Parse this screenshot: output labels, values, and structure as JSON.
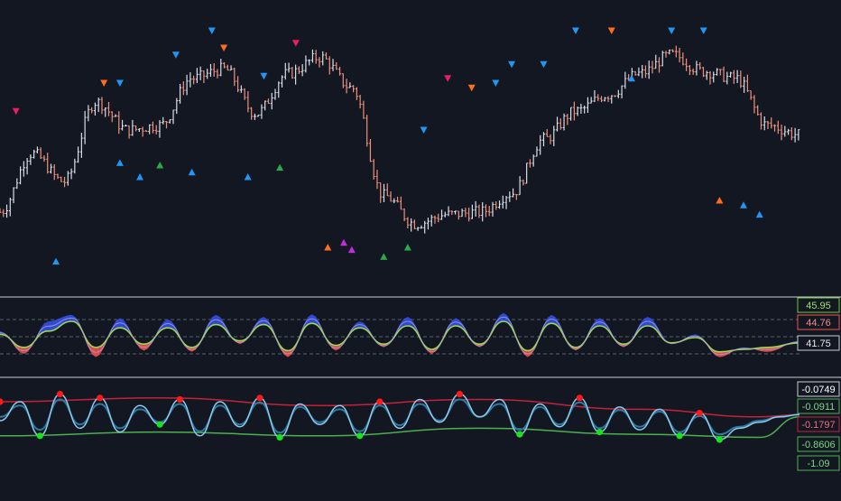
{
  "theme": {
    "background": "#131722",
    "separator": "#c8ccd4",
    "bar_up": "#d8dde6",
    "bar_down": "#f0907c",
    "signal_blue": "#2196f3",
    "signal_orange": "#ff6d1f",
    "signal_pink": "#e91e63",
    "signal_purple": "#c02ddb",
    "signal_green": "#2ea84a",
    "osc_fill_up": "#3550e6",
    "osc_fill_down": "#ef5350",
    "osc_line_green": "#9bd84f",
    "osc_line_purple": "#b39ddb",
    "wt_line_light": "#8ec8e8",
    "wt_line_dark": "#2a7aa5",
    "wt_upper_red": "#c2233a",
    "wt_lower_green": "#4caf50",
    "dot_red": "#ff1a1a",
    "dot_green": "#18e31e"
  },
  "chart_data": [
    {
      "type": "line",
      "panel": "price",
      "style": "ohlc-bars",
      "x_range": [
        0,
        200
      ],
      "y_range": [
        0,
        100
      ],
      "grid": false,
      "series": [
        {
          "x": [
            0,
            8,
            16,
            24,
            32,
            40,
            48,
            56,
            64,
            72,
            80,
            88,
            96,
            104,
            112,
            120,
            128,
            136,
            144,
            152,
            160,
            168,
            176,
            184,
            192,
            200
          ],
          "values": [
            25,
            50,
            38,
            72,
            60,
            62,
            82,
            86,
            67,
            84,
            91,
            78,
            32,
            20,
            24,
            25,
            33,
            56,
            68,
            75,
            84,
            92,
            85,
            82,
            62,
            58
          ]
        }
      ],
      "markers": [
        {
          "x": 4,
          "y": 68,
          "direction": "down",
          "color": "pink"
        },
        {
          "x": 14,
          "y": 4,
          "direction": "up",
          "color": "blue"
        },
        {
          "x": 26,
          "y": 80,
          "direction": "down",
          "color": "orange"
        },
        {
          "x": 30,
          "y": 80,
          "direction": "down",
          "color": "blue"
        },
        {
          "x": 30,
          "y": 46,
          "direction": "up",
          "color": "blue"
        },
        {
          "x": 35,
          "y": 40,
          "direction": "up",
          "color": "blue"
        },
        {
          "x": 40,
          "y": 45,
          "direction": "up",
          "color": "green"
        },
        {
          "x": 44,
          "y": 92,
          "direction": "down",
          "color": "blue"
        },
        {
          "x": 48,
          "y": 42,
          "direction": "up",
          "color": "blue"
        },
        {
          "x": 53,
          "y": 104,
          "direction": "down",
          "color": "blue"
        },
        {
          "x": 56,
          "y": 95,
          "direction": "down",
          "color": "orange"
        },
        {
          "x": 62,
          "y": 40,
          "direction": "up",
          "color": "blue"
        },
        {
          "x": 66,
          "y": 83,
          "direction": "down",
          "color": "blue"
        },
        {
          "x": 70,
          "y": 44,
          "direction": "up",
          "color": "green"
        },
        {
          "x": 74,
          "y": 97,
          "direction": "down",
          "color": "pink"
        },
        {
          "x": 82,
          "y": 10,
          "direction": "up",
          "color": "orange"
        },
        {
          "x": 86,
          "y": 12,
          "direction": "up",
          "color": "purple"
        },
        {
          "x": 88,
          "y": 9,
          "direction": "up",
          "color": "purple"
        },
        {
          "x": 96,
          "y": 6,
          "direction": "up",
          "color": "green"
        },
        {
          "x": 102,
          "y": 10,
          "direction": "up",
          "color": "green"
        },
        {
          "x": 106,
          "y": 60,
          "direction": "down",
          "color": "blue"
        },
        {
          "x": 112,
          "y": 82,
          "direction": "down",
          "color": "pink"
        },
        {
          "x": 118,
          "y": 78,
          "direction": "down",
          "color": "orange"
        },
        {
          "x": 124,
          "y": 80,
          "direction": "down",
          "color": "blue"
        },
        {
          "x": 128,
          "y": 88,
          "direction": "down",
          "color": "blue"
        },
        {
          "x": 136,
          "y": 88,
          "direction": "down",
          "color": "blue"
        },
        {
          "x": 144,
          "y": 105,
          "direction": "down",
          "color": "blue"
        },
        {
          "x": 153,
          "y": 130,
          "direction": "down",
          "color": "orange"
        },
        {
          "x": 158,
          "y": 82,
          "direction": "up",
          "color": "blue"
        },
        {
          "x": 168,
          "y": 120,
          "direction": "down",
          "color": "blue"
        },
        {
          "x": 176,
          "y": 115,
          "direction": "down",
          "color": "blue"
        },
        {
          "x": 180,
          "y": 30,
          "direction": "up",
          "color": "orange"
        },
        {
          "x": 186,
          "y": 28,
          "direction": "up",
          "color": "blue"
        },
        {
          "x": 190,
          "y": 24,
          "direction": "up",
          "color": "blue"
        }
      ]
    },
    {
      "type": "area",
      "panel": "oscillator",
      "x_range": [
        0,
        200
      ],
      "y_range": [
        0,
        100
      ],
      "grid": true,
      "scale_labels": [
        "45.95",
        "44.76",
        "41.75"
      ],
      "series": [
        {
          "x": [
            0,
            6,
            12,
            18,
            24,
            30,
            36,
            42,
            48,
            54,
            60,
            66,
            72,
            78,
            84,
            90,
            96,
            102,
            108,
            114,
            120,
            126,
            132,
            138,
            144,
            150,
            156,
            162,
            168,
            174,
            180,
            186,
            192,
            200
          ],
          "values": [
            60,
            25,
            75,
            85,
            20,
            80,
            30,
            78,
            28,
            85,
            40,
            82,
            20,
            86,
            30,
            75,
            35,
            82,
            25,
            80,
            35,
            88,
            20,
            85,
            30,
            80,
            35,
            82,
            40,
            55,
            20,
            35,
            28,
            45
          ]
        },
        {
          "x": [
            0,
            6,
            12,
            18,
            24,
            30,
            36,
            42,
            48,
            54,
            60,
            66,
            72,
            78,
            84,
            90,
            96,
            102,
            108,
            114,
            120,
            126,
            132,
            138,
            144,
            150,
            156,
            162,
            168,
            174,
            180,
            186,
            192,
            200
          ],
          "values": [
            55,
            35,
            60,
            75,
            35,
            65,
            40,
            65,
            35,
            70,
            45,
            70,
            30,
            72,
            38,
            65,
            40,
            68,
            32,
            68,
            40,
            75,
            30,
            72,
            35,
            68,
            40,
            68,
            42,
            50,
            28,
            32,
            35,
            42
          ]
        }
      ]
    },
    {
      "type": "line",
      "panel": "wave",
      "x_range": [
        0,
        200
      ],
      "y_range": [
        0,
        100
      ],
      "grid": false,
      "scale_labels": [
        "-0.0749",
        "-0.0911",
        "-0.1797",
        "-0.8606",
        "-1.09"
      ],
      "series": [
        {
          "x": [
            0,
            5,
            10,
            15,
            20,
            25,
            30,
            35,
            40,
            45,
            50,
            55,
            60,
            65,
            70,
            75,
            80,
            85,
            90,
            95,
            100,
            105,
            110,
            115,
            120,
            125,
            130,
            135,
            140,
            145,
            150,
            155,
            160,
            165,
            170,
            175,
            180,
            185,
            190,
            195,
            200
          ],
          "values": [
            50,
            75,
            30,
            85,
            40,
            80,
            35,
            70,
            45,
            78,
            30,
            75,
            42,
            80,
            28,
            72,
            45,
            70,
            30,
            75,
            40,
            78,
            48,
            85,
            55,
            78,
            32,
            72,
            42,
            80,
            35,
            68,
            38,
            65,
            30,
            60,
            25,
            40,
            48,
            55,
            58
          ]
        },
        {
          "x": [
            0,
            5,
            10,
            15,
            20,
            25,
            30,
            35,
            40,
            45,
            50,
            55,
            60,
            65,
            70,
            75,
            80,
            85,
            90,
            95,
            100,
            105,
            110,
            115,
            120,
            125,
            130,
            135,
            140,
            145,
            150,
            155,
            160,
            165,
            170,
            175,
            180,
            185,
            190,
            195,
            200
          ],
          "values": [
            55,
            70,
            38,
            78,
            45,
            72,
            40,
            65,
            48,
            72,
            36,
            70,
            45,
            74,
            34,
            68,
            48,
            65,
            36,
            70,
            44,
            72,
            50,
            78,
            55,
            72,
            38,
            68,
            45,
            74,
            40,
            64,
            42,
            62,
            35,
            56,
            32,
            42,
            50,
            55,
            58
          ]
        },
        {
          "x": [
            0,
            40,
            80,
            120,
            160,
            190,
            200
          ],
          "values": [
            75,
            80,
            70,
            78,
            65,
            55,
            58
          ]
        },
        {
          "x": [
            0,
            40,
            80,
            120,
            160,
            190,
            200
          ],
          "values": [
            30,
            35,
            30,
            40,
            32,
            28,
            55
          ]
        }
      ],
      "dots_red": [
        {
          "x": 0,
          "y": 75
        },
        {
          "x": 15,
          "y": 85
        },
        {
          "x": 25,
          "y": 80
        },
        {
          "x": 45,
          "y": 78
        },
        {
          "x": 65,
          "y": 80
        },
        {
          "x": 95,
          "y": 75
        },
        {
          "x": 115,
          "y": 85
        },
        {
          "x": 145,
          "y": 80
        },
        {
          "x": 175,
          "y": 60
        }
      ],
      "dots_green": [
        {
          "x": 10,
          "y": 30
        },
        {
          "x": 40,
          "y": 45
        },
        {
          "x": 70,
          "y": 28
        },
        {
          "x": 90,
          "y": 30
        },
        {
          "x": 130,
          "y": 32
        },
        {
          "x": 150,
          "y": 35
        },
        {
          "x": 170,
          "y": 30
        },
        {
          "x": 180,
          "y": 25
        }
      ]
    }
  ]
}
